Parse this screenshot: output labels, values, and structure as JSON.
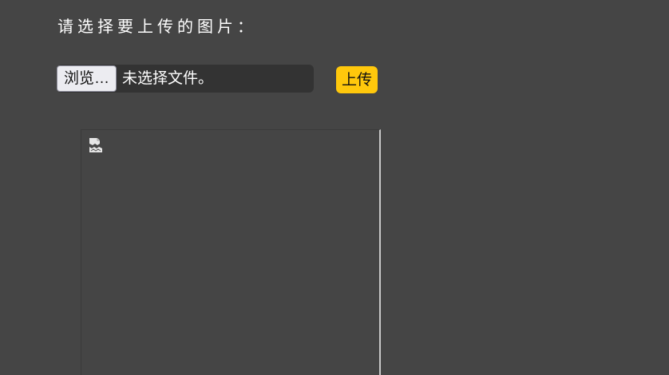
{
  "prompt": {
    "text": "请选择要上传的图片："
  },
  "file_input": {
    "browse_label": "浏览…",
    "status_text": "未选择文件。"
  },
  "upload_button": {
    "label": "上传",
    "color": "#ffc80c"
  },
  "preview": {
    "icon": "broken-image-icon"
  }
}
